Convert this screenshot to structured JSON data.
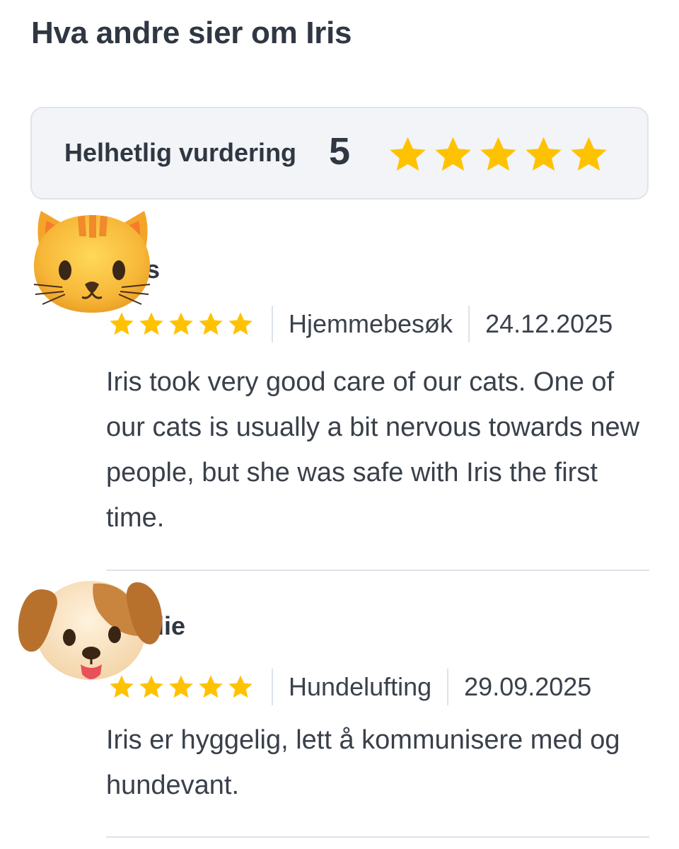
{
  "heading": "Hva andre sier om Iris",
  "summary": {
    "label": "Helhetlig vurdering",
    "score": "5",
    "stars": 5
  },
  "colors": {
    "star": "#FFC200",
    "text": "#333a44",
    "summary_bg": "#f2f4f7",
    "divider": "#dde3ea"
  },
  "reviews": [
    {
      "avatar": "cat-face-icon",
      "name_fragment": "s",
      "rating": 5,
      "service": "Hjemmebesøk",
      "date": "24.12.2025",
      "text": "Iris took very good care of our cats. One of our cats is usually a bit nervous towards new people, but she was safe with Iris the first time."
    },
    {
      "avatar": "dog-face-icon",
      "name_fragment": "lie",
      "rating": 5,
      "service": "Hundelufting",
      "date": "29.09.2025",
      "text": "Iris er hyggelig, lett å kommunisere med og hundevant."
    }
  ]
}
